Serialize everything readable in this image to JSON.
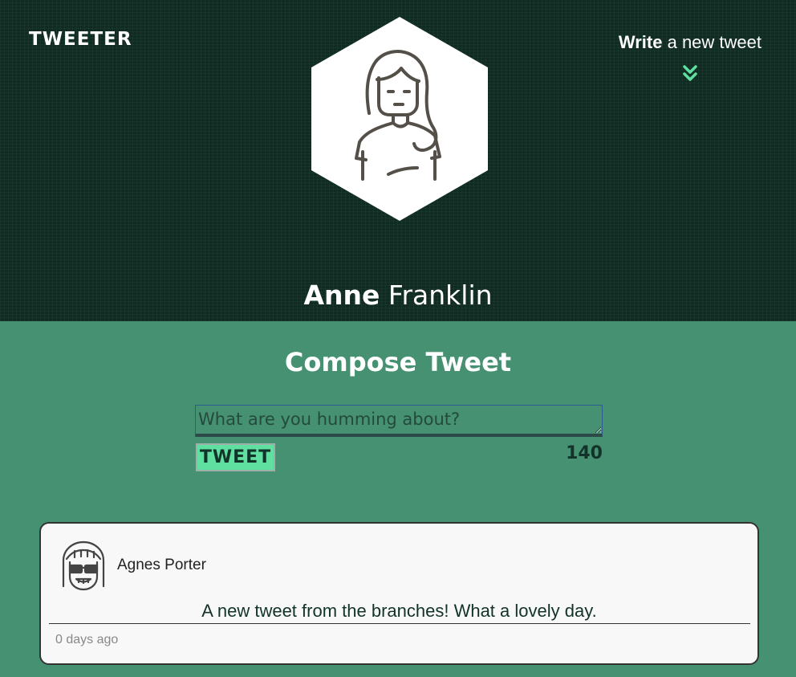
{
  "header": {
    "brand": "TWEETER",
    "write_bold": "Write",
    "write_rest": "a new tweet",
    "chevron_icon": "double-chevron-down-icon",
    "avatar_icon": "woman-long-hair-avatar-icon",
    "profile_first": "Anne",
    "profile_last": "Franklin"
  },
  "compose": {
    "title": "Compose Tweet",
    "placeholder": "What are you humming about?",
    "button_label": "TWEET",
    "counter": "140"
  },
  "tweets": [
    {
      "avatar_icon": "girl-sunglasses-avatar-icon",
      "author": "Agnes Porter",
      "text": "A new tweet from the branches! What a lovely day.",
      "time": "0 days ago"
    }
  ],
  "colors": {
    "header_bg": "#112a22",
    "page_bg": "#469171",
    "accent": "#5fe0a0",
    "card_bg": "#f8f8f8"
  }
}
